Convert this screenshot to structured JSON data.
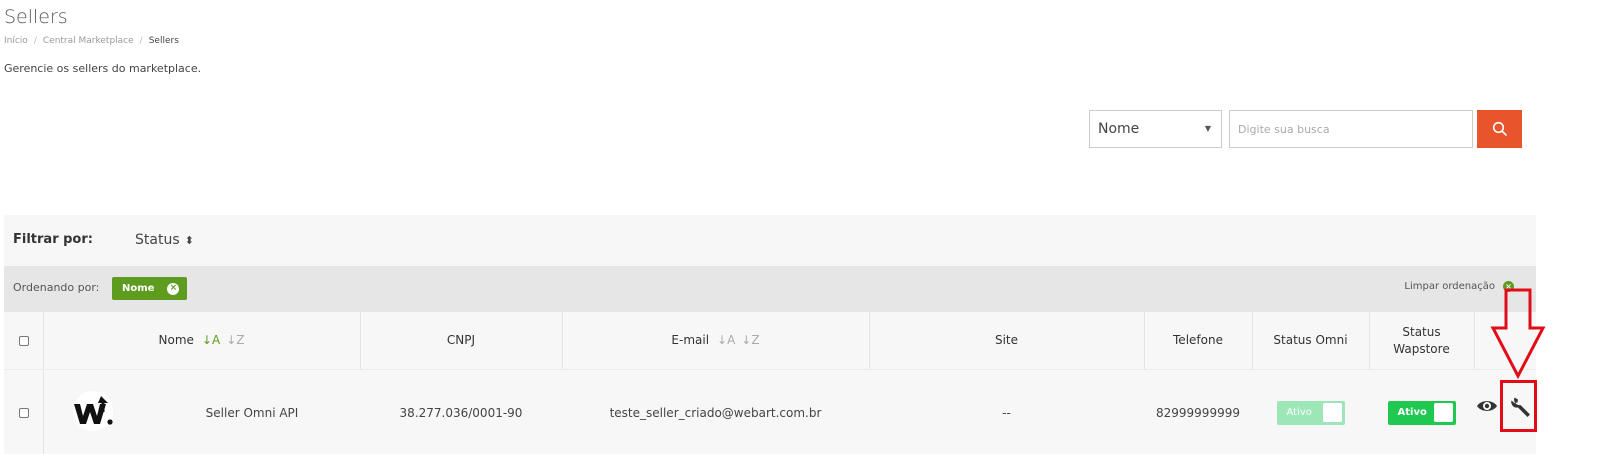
{
  "page": {
    "title": "Sellers",
    "description": "Gerencie os sellers do marketplace."
  },
  "breadcrumb": [
    "Início",
    "Central Marketplace",
    "Sellers"
  ],
  "search": {
    "field_selected": "Nome",
    "placeholder": "Digite sua busca",
    "button_icon": "search-icon",
    "button_color": "#e8542b"
  },
  "filter": {
    "label": "Filtrar por:",
    "status_label": "Status",
    "status_icon": "sort-updown-icon"
  },
  "sorting": {
    "label": "Ordenando por:",
    "chip": "Nome",
    "clear_label": "Limpar ordenação",
    "accent_color": "#5d9c1f"
  },
  "table": {
    "columns": {
      "nome": "Nome",
      "cnpj": "CNPJ",
      "email": "E-mail",
      "site": "Site",
      "telefone": "Telefone",
      "status_omni": "Status Omni",
      "status_wapstore_line1": "Status",
      "status_wapstore_line2": "Wapstore"
    },
    "sort_icons": {
      "asc": "↓A",
      "desc": "↓Z"
    },
    "rows": [
      {
        "logo_text": "W.",
        "nome": "Seller Omni API",
        "cnpj": "38.277.036/0001-90",
        "email": "teste_seller_criado@webart.com.br",
        "site": "--",
        "telefone": "82999999999",
        "status_omni": "Ativo",
        "status_wapstore": "Ativo",
        "actions": [
          "eye-icon",
          "wrench-icon"
        ]
      }
    ]
  },
  "annotation": {
    "color": "#e10c18"
  }
}
